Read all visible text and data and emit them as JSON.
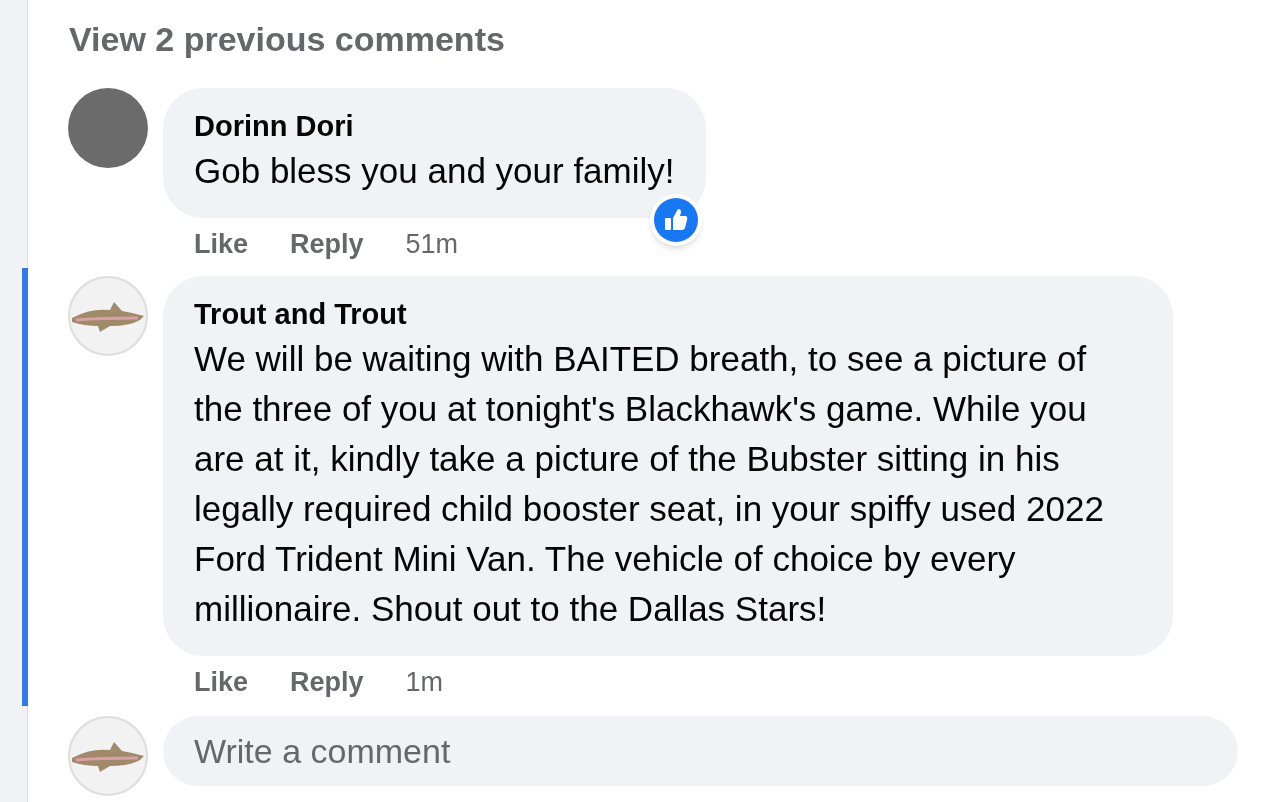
{
  "previous_comments_link": "View 2 previous comments",
  "comments": [
    {
      "author": "Dorinn Dori",
      "avatar": {
        "kind": "photo"
      },
      "text": "Gob bless you and your family!",
      "has_like_reaction": true,
      "highlighted": false,
      "actions": [
        "Like",
        "Reply"
      ],
      "time": "51m"
    },
    {
      "author": "Trout and Trout",
      "avatar": {
        "kind": "fish"
      },
      "text": "We will be waiting with BAITED breath, to see a picture of the three of you at tonight's Blackhawk's game. While you are at it, kindly take a picture of the Bubster sitting in his legally required child booster seat, in your spiffy used 2022 Ford Trident Mini Van. The vehicle of choice by every millionaire. Shout out to the Dallas Stars!",
      "has_like_reaction": false,
      "highlighted": true,
      "actions": [
        "Like",
        "Reply"
      ],
      "time": "1m"
    }
  ],
  "composer": {
    "avatar": {
      "kind": "fish"
    },
    "placeholder": "Write a comment"
  }
}
